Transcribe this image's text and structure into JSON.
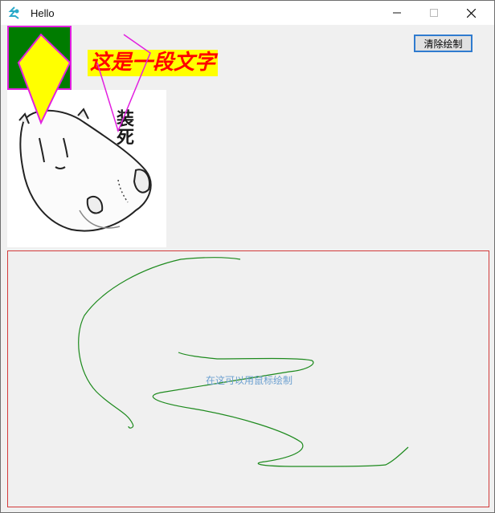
{
  "window": {
    "title": "Hello"
  },
  "toolbar": {
    "clear_label": "清除绘制"
  },
  "canvas_text": "这是一段文字",
  "picture": {
    "caption": "装死"
  },
  "draw_area": {
    "hint": "在这可以用鼠标绘制"
  },
  "colors": {
    "green_box": "#007c00",
    "shape_outline": "#e21fe0",
    "shape_fill": "#ffff00",
    "text_color": "#ff0000",
    "stroke_color": "#1d8a1d",
    "draw_border": "#d23a3a"
  },
  "icons": {
    "app": "app-icon",
    "minimize": "minimize-icon",
    "maximize": "maximize-icon",
    "close": "close-icon"
  }
}
